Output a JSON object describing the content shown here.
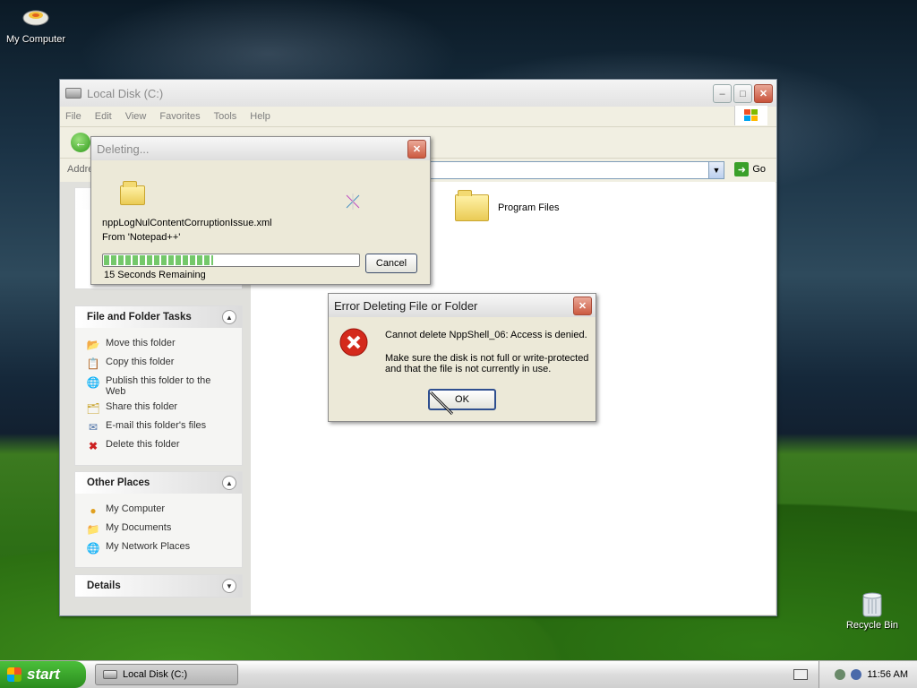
{
  "desktop": {
    "icons": [
      {
        "label": "My Computer",
        "icon": "my-computer-icon"
      },
      {
        "label": "Recycle Bin",
        "icon": "recycle-bin-icon"
      }
    ]
  },
  "explorer": {
    "title": "Local Disk (C:)",
    "menu": [
      "File",
      "Edit",
      "View",
      "Favorites",
      "Tools",
      "Help"
    ],
    "address_label": "Addre",
    "address_value": "",
    "go_label": "Go",
    "file_folder_tasks": {
      "title": "File and Folder Tasks",
      "items": [
        {
          "label": "Move this folder",
          "icon": "move-folder-icon"
        },
        {
          "label": "Copy this folder",
          "icon": "copy-folder-icon"
        },
        {
          "label": "Publish this folder to the Web",
          "icon": "publish-web-icon"
        },
        {
          "label": "Share this folder",
          "icon": "share-folder-icon"
        },
        {
          "label": "E-mail this folder's files",
          "icon": "email-icon"
        },
        {
          "label": "Delete this folder",
          "icon": "delete-icon"
        }
      ]
    },
    "other_places": {
      "title": "Other Places",
      "items": [
        {
          "label": "My Computer",
          "icon": "my-computer-icon"
        },
        {
          "label": "My Documents",
          "icon": "my-documents-icon"
        },
        {
          "label": "My Network Places",
          "icon": "network-icon"
        }
      ]
    },
    "details": {
      "title": "Details"
    },
    "files": [
      {
        "name": "Program Files",
        "type": "folder"
      }
    ]
  },
  "deleting_dialog": {
    "title": "Deleting...",
    "file_name": "nppLogNulContentCorruptionIssue.xml",
    "from_text": "From 'Notepad++'",
    "remaining": "15 Seconds Remaining",
    "progress_percent": 43,
    "cancel_label": "Cancel"
  },
  "error_dialog": {
    "title": "Error Deleting File or Folder",
    "message": "Cannot delete NppShell_06: Access is denied.",
    "detail_line1": "Make sure the disk is not full or write-protected",
    "detail_line2": "and that the file is not currently in use.",
    "ok_label": "OK"
  },
  "taskbar": {
    "start_label": "start",
    "task_button": "Local Disk (C:)",
    "clock": "11:56 AM"
  }
}
